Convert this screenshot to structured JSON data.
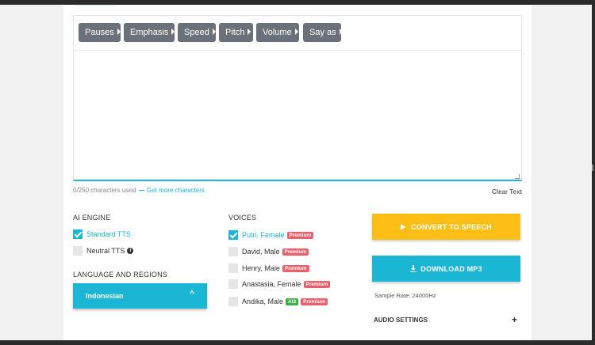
{
  "toolbar": {
    "buttons": [
      "Pauses",
      "Emphasis",
      "Speed",
      "Pitch",
      "Volume",
      "Say as"
    ]
  },
  "editor": {
    "char_count": "0/250 characters used",
    "more_chars_link": "Get more characters",
    "clear_text": "Clear Text"
  },
  "ai_engine": {
    "title": "AI ENGINE",
    "options": [
      {
        "label": "Standard TTS",
        "checked": true
      },
      {
        "label": "Neutral TTS",
        "checked": false,
        "info_icon": "info-icon"
      }
    ]
  },
  "language": {
    "title": "LANGUAGE AND REGIONS",
    "selected": "Indonesian",
    "chevron": "^"
  },
  "voices": {
    "title": "VOICES",
    "items": [
      {
        "label": "Putri, Female",
        "checked": true,
        "badges": [
          "Premium"
        ]
      },
      {
        "label": "David, Male",
        "checked": false,
        "badges": [
          "Premium"
        ]
      },
      {
        "label": "Henry, Male",
        "checked": false,
        "badges": [
          "Premium"
        ]
      },
      {
        "label": "Anastasia, Female",
        "checked": false,
        "badges": [
          "Premium"
        ]
      },
      {
        "label": "Andika, Male",
        "checked": false,
        "badges": [
          "AI3",
          "Premium"
        ]
      }
    ]
  },
  "actions": {
    "convert_label": "CONVERT TO SPEECH",
    "download_label": "DOWNLOAD MP3",
    "sample_rate": "Sample Rate: 24000Hz",
    "audio_settings": "AUDIO SETTINGS",
    "expand_symbol": "+"
  },
  "colors": {
    "accent": "#1ab6d3",
    "convert": "#fdbf16",
    "toolbar_button": "#6b7178",
    "badge_premium": "#e8626e",
    "badge_green": "#3fae49"
  }
}
